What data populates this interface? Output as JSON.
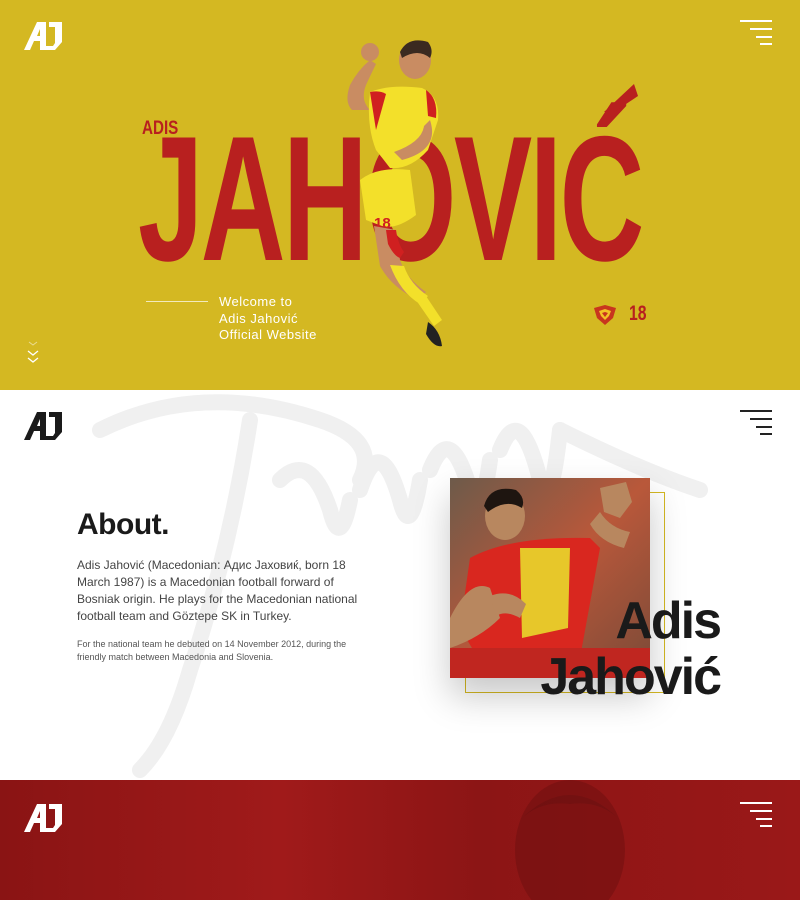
{
  "brand": {
    "logo_text": "AJ"
  },
  "hero": {
    "first_name": "ADIS",
    "last_name": "JAHOVIĆ",
    "welcome_lines": [
      "Welcome to",
      "Adis Jahović",
      "Official Website"
    ],
    "shirt_number": "18",
    "icons": [
      "logo-icon",
      "menu-icon",
      "club-badge-icon",
      "scroll-down-icon"
    ]
  },
  "about": {
    "title": "About.",
    "paragraph": "Adis Jahović (Macedonian: Адис Јаховиќ, born 18 March 1987) is a Macedonian football forward of Bosniak origin. He plays for the Macedonian national football team and Göztepe SK in Turkey.",
    "small_text": "For the national team he debuted on 14 November 2012, during the friendly match between Macedonia and Slovenia.",
    "name_line1": "Adis",
    "name_line2": "Jahović"
  },
  "colors": {
    "hero_bg": "#d4b822",
    "accent_red": "#b8201f",
    "dark_text": "#1a1a1a",
    "bottom_bg": "#9a1818"
  }
}
